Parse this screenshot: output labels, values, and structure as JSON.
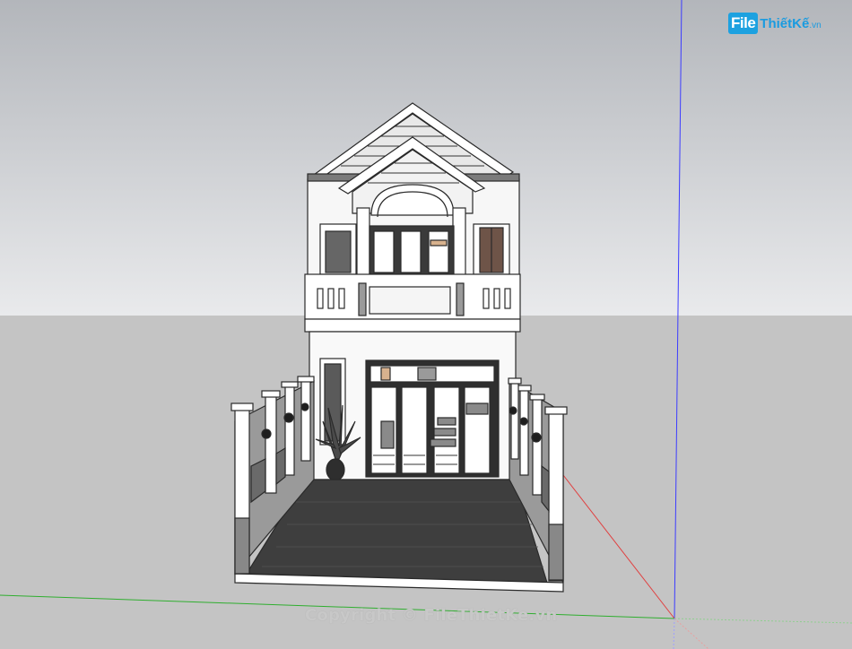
{
  "logo": {
    "mark": "File",
    "text": "ThiếtKế",
    "suffix": ".vn"
  },
  "watermark": "Copyright © FileThietKe.vn",
  "colors": {
    "sky_top": "#b5b8bd",
    "sky_bottom": "#e6e7e9",
    "ground": "#c4c4c4",
    "axis_blue": "#3c3cff",
    "axis_red": "#e04040",
    "axis_green": "#2fae2f",
    "accent_logo": "#1da1e0"
  }
}
